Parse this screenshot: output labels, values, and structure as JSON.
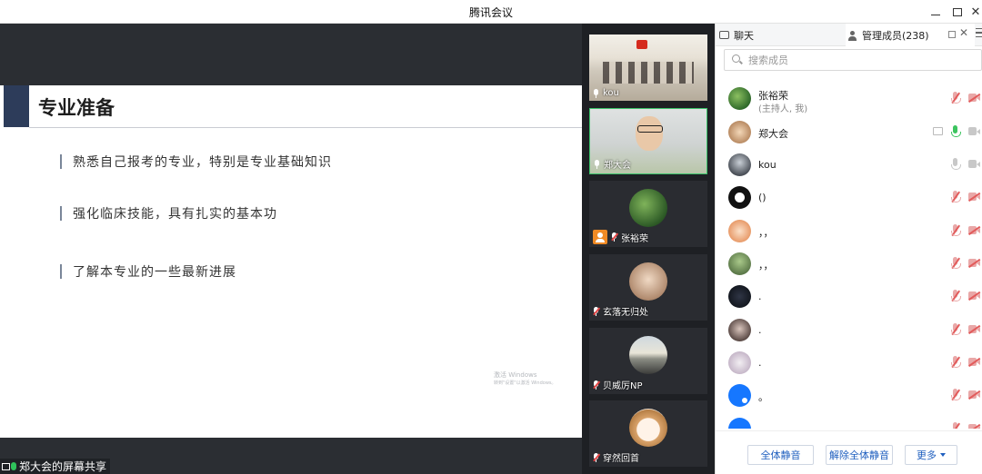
{
  "window": {
    "title": "腾讯会议"
  },
  "slide": {
    "heading": "专业准备",
    "bullets": [
      "熟悉自己报考的专业，特别是专业基础知识",
      "强化临床技能，具有扎实的基本功",
      "了解本专业的一些最新进展"
    ],
    "watermark_line1": "激活 Windows",
    "watermark_line2": "转到\"设置\"以激活 Windows。"
  },
  "share_label": "郑大会的屏幕共享",
  "video_tiles": [
    {
      "name": "kou",
      "mic": "on"
    },
    {
      "name": "郑大会",
      "mic": "on"
    },
    {
      "name": "张裕荣",
      "mic": "muted",
      "host": true
    },
    {
      "name": "玄落无归处",
      "mic": "muted"
    },
    {
      "name": "贝威厉NP",
      "mic": "muted"
    },
    {
      "name": "穿然回首",
      "mic": "muted"
    }
  ],
  "panel": {
    "tab_chat": "聊天",
    "tab_members": "管理成员(238)",
    "search_placeholder": "搜索成员",
    "members": [
      {
        "name": "张裕荣",
        "role": "(主持人, 我)",
        "mic": "muted",
        "cam": "off"
      },
      {
        "name": "郑大会",
        "role": "",
        "mic": "live",
        "cam": "on",
        "sharing": true
      },
      {
        "name": "kou",
        "role": "",
        "mic": "on",
        "cam": "on"
      },
      {
        "name": "()",
        "role": "",
        "mic": "muted",
        "cam": "off"
      },
      {
        "name": "，，",
        "role": "",
        "mic": "muted",
        "cam": "off"
      },
      {
        "name": "，，",
        "role": "",
        "mic": "muted",
        "cam": "off"
      },
      {
        "name": ".",
        "role": "",
        "mic": "muted",
        "cam": "off"
      },
      {
        "name": ".",
        "role": "",
        "mic": "muted",
        "cam": "off"
      },
      {
        "name": ".",
        "role": "",
        "mic": "muted",
        "cam": "off"
      },
      {
        "name": "。",
        "role": "",
        "mic": "muted",
        "cam": "off"
      },
      {
        "name": ".",
        "role": "",
        "mic": "muted",
        "cam": "off"
      }
    ],
    "btn_mute_all": "全体静音",
    "btn_unmute_all": "解除全体静音",
    "btn_more": "更多"
  }
}
